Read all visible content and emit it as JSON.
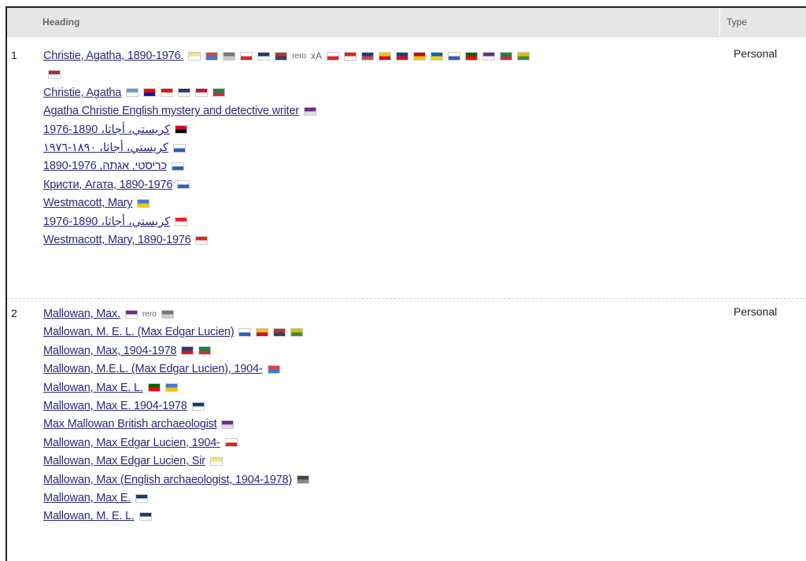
{
  "header": {
    "heading": "Heading",
    "type": "Type"
  },
  "rows": [
    {
      "num": "1",
      "type": "Personal",
      "lines": [
        {
          "text": "Christie, Agatha, 1890-1976.",
          "flags": [
            "be-flag",
            "fr-flag",
            "nl-flag",
            "jp-flag",
            "dnb-flag",
            "us-flag",
            "rero",
            "xa",
            "pl-flag",
            "ca-flag",
            "au-flag",
            "ct-flag",
            "cz-flag",
            "es-flag",
            "se-flag",
            "il-flag",
            "pt-flag",
            "nu-flag",
            "it-flag",
            "ar-flag"
          ]
        },
        {
          "text": "",
          "flags": [
            "lv-flag"
          ]
        },
        {
          "text": "Christie, Agatha",
          "flags": [
            "nucc-flag",
            "hr-flag",
            "ch-flag",
            "dnb-flag",
            "dk-flag",
            "it-flag"
          ]
        },
        {
          "text": "Agatha Christie English mystery and detective writer",
          "flags": [
            "wiki-flag"
          ]
        },
        {
          "text": "كريستي، أجاثا، 1890-1976",
          "flags": [
            "eg-flag"
          ]
        },
        {
          "text": "كريستي، أجاثا، ١٨٩٠-١٩٧٦",
          "flags": [
            "il-flag"
          ]
        },
        {
          "text": "כריסטי, אגתה, 1890-1976",
          "flags": [
            "il-flag"
          ]
        },
        {
          "text": "Кристи, Агата, 1890-1976",
          "flags": [
            "il-flag"
          ]
        },
        {
          "text": "Westmacott, Mary",
          "flags": [
            "bav-flag"
          ]
        },
        {
          "text": "كريستي، أجاثا، 1890-1976",
          "flags": [
            "lb-flag"
          ]
        },
        {
          "text": "Westmacott, Mary, 1890-1976",
          "flags": [
            "ca-flag"
          ]
        }
      ]
    },
    {
      "num": "2",
      "type": "Personal",
      "lines": [
        {
          "text": "Mallowan, Max.",
          "flags": [
            "nu-flag",
            "rero",
            "nl-flag"
          ]
        },
        {
          "text": "Mallowan, M. E. L. (Max Edgar Lucien)",
          "flags": [
            "il-flag",
            "ct-flag",
            "us-flag",
            "ar-flag"
          ]
        },
        {
          "text": "Mallowan, Max, 1904-1978",
          "flags": [
            "cz-flag",
            "it-flag"
          ]
        },
        {
          "text": "Mallowan, M.E.L. (Max Edgar Lucien), 1904-",
          "flags": [
            "fr-flag"
          ]
        },
        {
          "text": "Mallowan, Max E. L.",
          "flags": [
            "pt-flag",
            "bav-flag"
          ]
        },
        {
          "text": "Mallowan, Max E. 1904-1978",
          "flags": [
            "dnb-flag"
          ]
        },
        {
          "text": "Max Mallowan British archaeologist",
          "flags": [
            "wiki-flag"
          ]
        },
        {
          "text": "Mallowan, Max Edgar Lucien, 1904-",
          "flags": [
            "jp-flag"
          ]
        },
        {
          "text": "Mallowan, Max Edgar Lucien, Sir",
          "flags": [
            "be-flag"
          ]
        },
        {
          "text": "Mallowan, Max (English archaeologist, 1904-1978)",
          "flags": [
            "getty-flag"
          ]
        },
        {
          "text": "Mallowan, Max E.",
          "flags": [
            "dnb-flag"
          ]
        },
        {
          "text": "Mallowan, M. E. L.",
          "flags": [
            "dnb-flag"
          ]
        }
      ]
    }
  ],
  "flag_colors": {
    "be-flag": [
      "#f6e27a",
      "#fff"
    ],
    "fr-flag": [
      "#e04040",
      "#3b7bd6"
    ],
    "nl-flag": [
      "#777",
      "#ccc"
    ],
    "jp-flag": [
      "#fff",
      "#d12a2a"
    ],
    "dnb-flag": [
      "#1b3d6e",
      "#fff"
    ],
    "us-flag": [
      "#b33",
      "#345"
    ],
    "pl-flag": [
      "#fff",
      "#e0202a"
    ],
    "ca-flag": [
      "#d52b1e",
      "#fff"
    ],
    "au-flag": [
      "#1c3b80",
      "#c44"
    ],
    "ct-flag": [
      "#f3c20b",
      "#c8102e"
    ],
    "cz-flag": [
      "#11457e",
      "#d7141a"
    ],
    "es-flag": [
      "#c60b1e",
      "#ffc400"
    ],
    "se-flag": [
      "#006aa7",
      "#fecc00"
    ],
    "il-flag": [
      "#fff",
      "#2a5fbf"
    ],
    "pt-flag": [
      "#006600",
      "#ff0000"
    ],
    "nu-flag": [
      "#6a2c86",
      "#fff"
    ],
    "it-flag": [
      "#009246",
      "#ce2b37"
    ],
    "ar-flag": [
      "#e6b800",
      "#3a8a3a"
    ],
    "lv-flag": [
      "#9e3039",
      "#fff"
    ],
    "nucc-flag": [
      "#5a9fd4",
      "#fff"
    ],
    "hr-flag": [
      "#ff0000",
      "#171796"
    ],
    "ch-flag": [
      "#ff0000",
      "#fff"
    ],
    "dk-flag": [
      "#c8102e",
      "#fff"
    ],
    "wiki-flag": [
      "#6a2c86",
      "#ddd"
    ],
    "eg-flag": [
      "#ce1126",
      "#000"
    ],
    "bav-flag": [
      "#3b7bd6",
      "#f1c40f"
    ],
    "lb-flag": [
      "#ed1c24",
      "#fff"
    ],
    "getty-flag": [
      "#444",
      "#888"
    ]
  }
}
